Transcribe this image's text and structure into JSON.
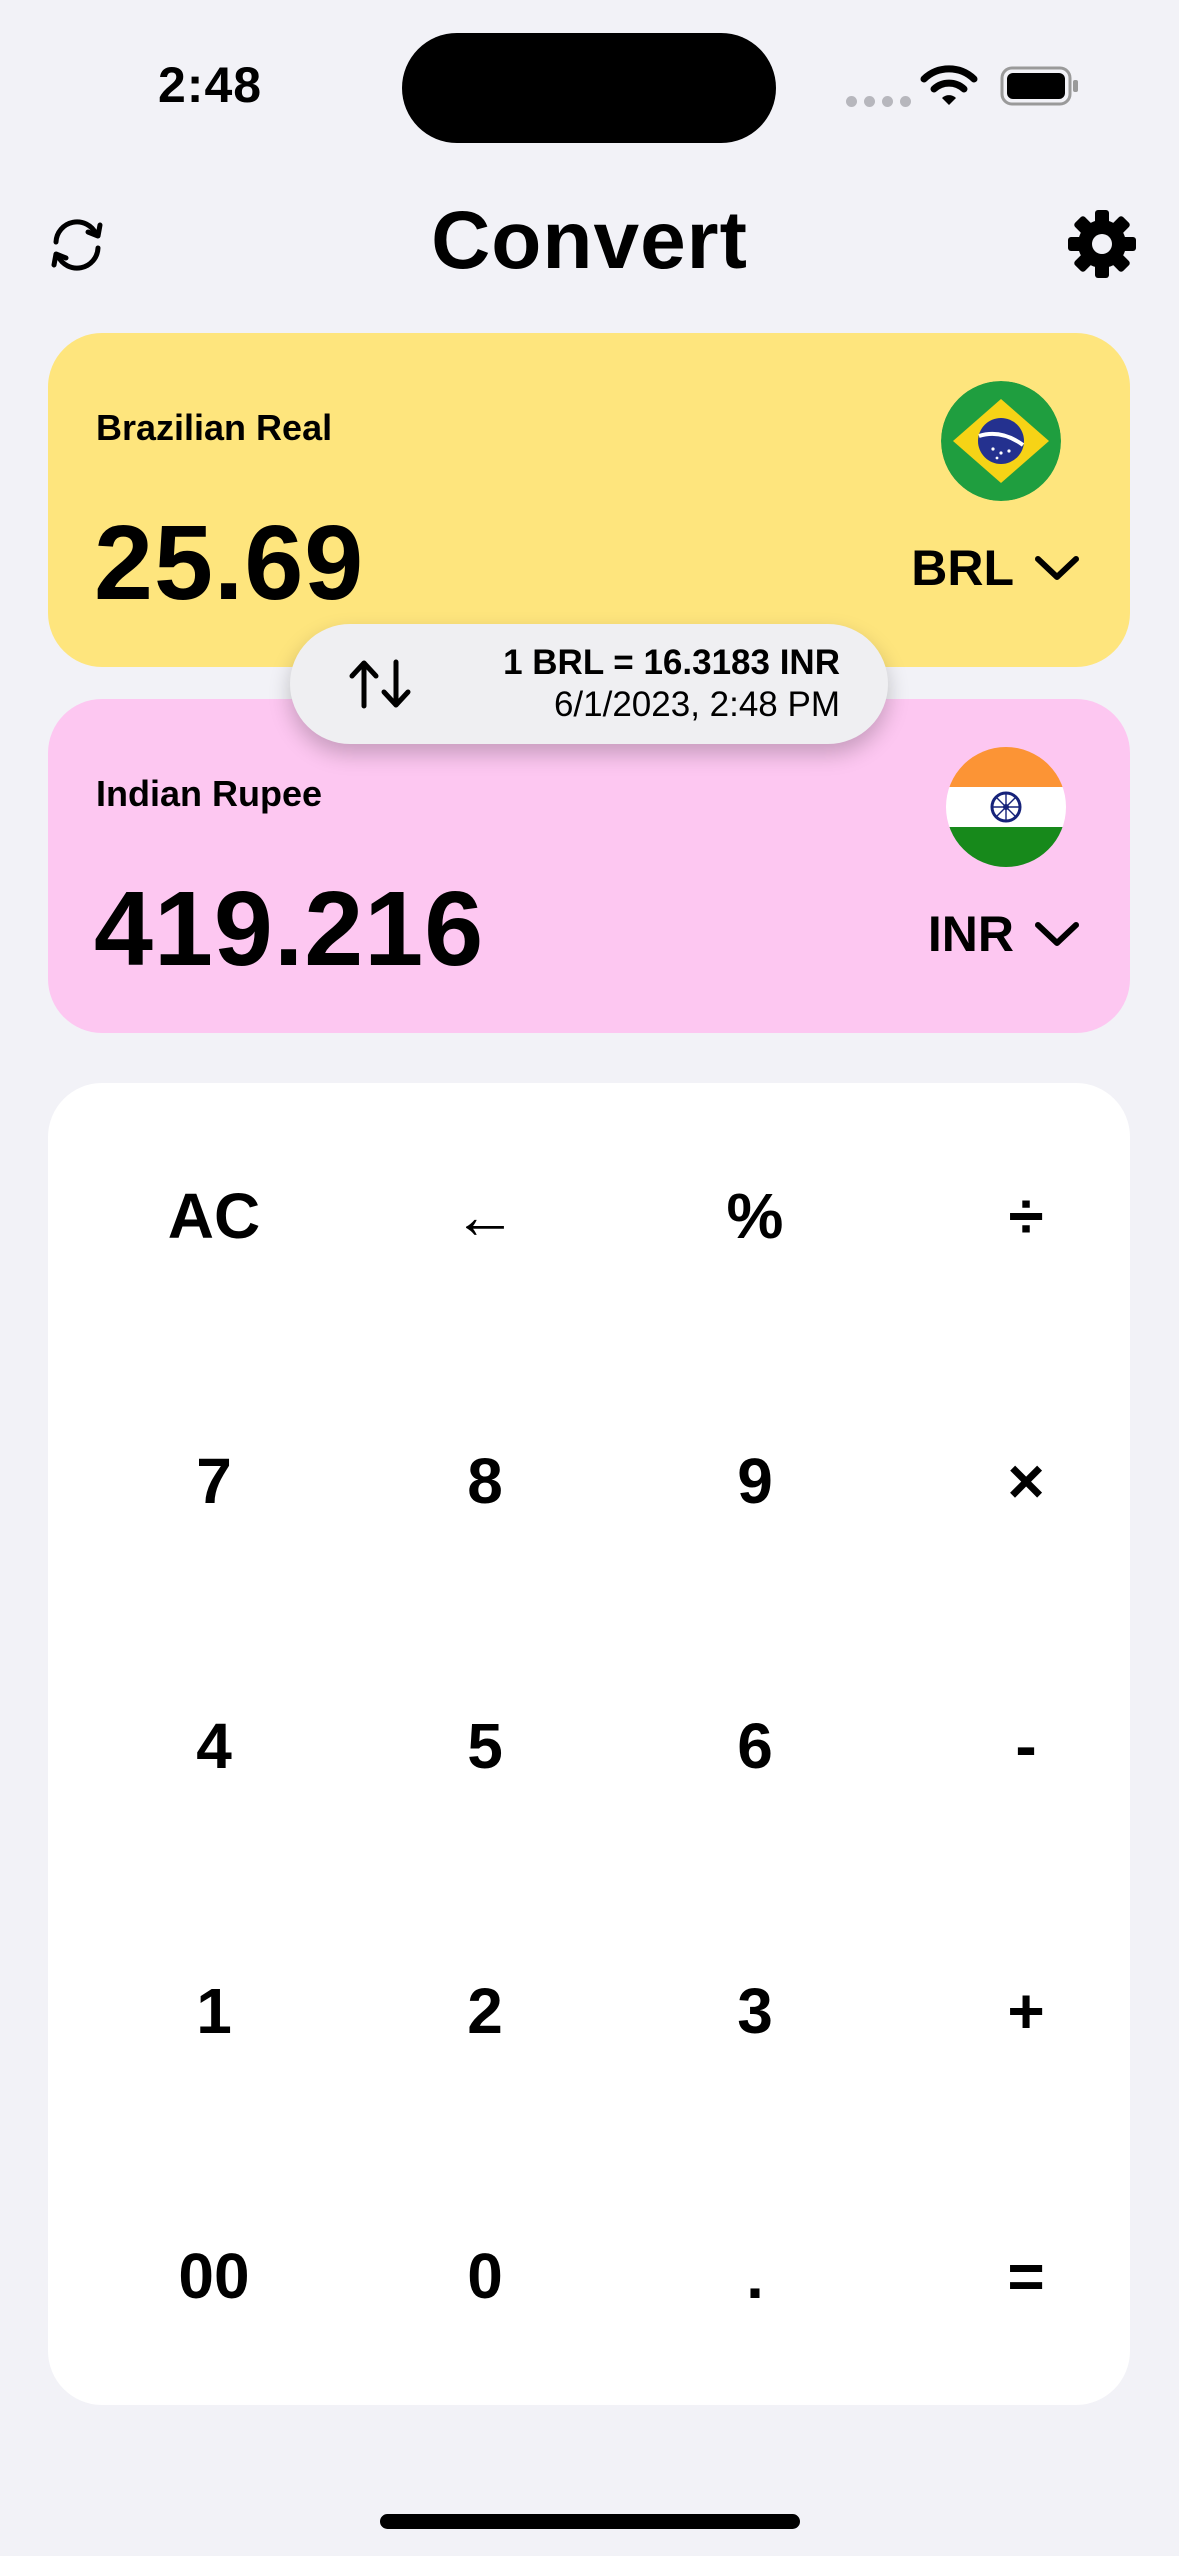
{
  "status_bar": {
    "time": "2:48"
  },
  "header": {
    "title": "Convert"
  },
  "from_currency": {
    "name": "Brazilian Real",
    "amount": "25.69",
    "code": "BRL",
    "flag": "brazil-flag-icon",
    "color": "#fee57d"
  },
  "to_currency": {
    "name": "Indian Rupee",
    "amount": "419.216",
    "code": "INR",
    "flag": "india-flag-icon",
    "color": "#fdc7f1"
  },
  "rate": {
    "line1": "1 BRL = 16.3183 INR",
    "line2": "6/1/2023, 2:48 PM"
  },
  "keypad": {
    "keys": [
      [
        "AC",
        "←",
        "%",
        "÷"
      ],
      [
        "7",
        "8",
        "9",
        "×"
      ],
      [
        "4",
        "5",
        "6",
        "-"
      ],
      [
        "1",
        "2",
        "3",
        "+"
      ],
      [
        "00",
        "0",
        ".",
        "="
      ]
    ]
  }
}
